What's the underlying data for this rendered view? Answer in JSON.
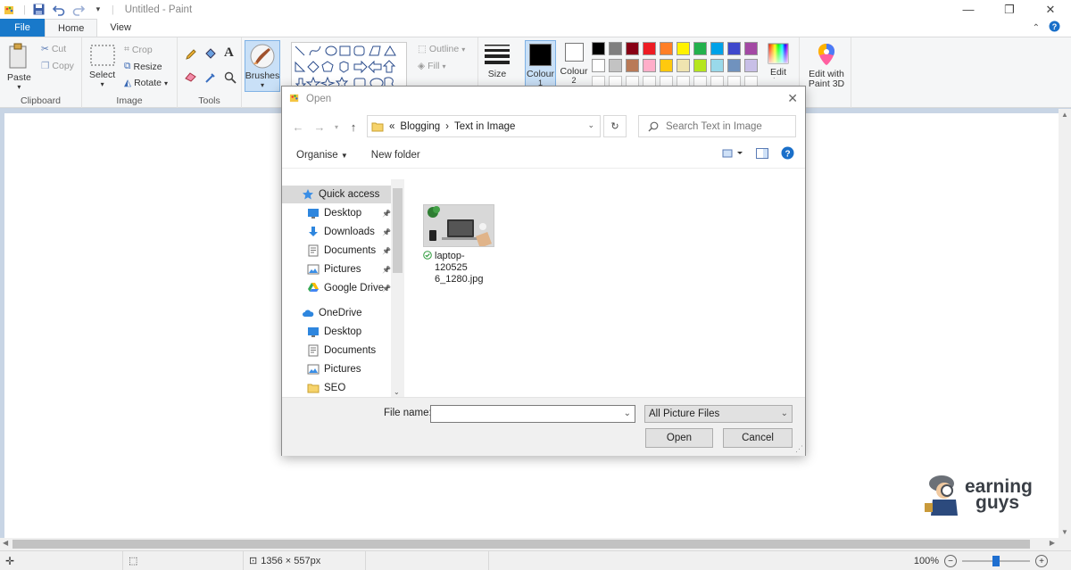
{
  "window": {
    "title": "Untitled - Paint",
    "minimize_glyph": "—",
    "restore_glyph": "❐",
    "close_glyph": "✕"
  },
  "tabs": [
    {
      "label": "File"
    },
    {
      "label": "Home"
    },
    {
      "label": "View"
    }
  ],
  "ribbon": {
    "clipboard": {
      "group": "Clipboard",
      "paste": "Paste",
      "cut": "Cut",
      "copy": "Copy"
    },
    "image": {
      "group": "Image",
      "select": "Select",
      "crop": "Crop",
      "resize": "Resize",
      "rotate": "Rotate"
    },
    "tools": {
      "group": "Tools"
    },
    "brushes": "Brushes",
    "shapes": {
      "outline": "Outline",
      "fill": "Fill"
    },
    "size": "Size",
    "colour1": "Colour",
    "colour1_num": "1",
    "colour2": "Colour",
    "colour2_num": "2",
    "edit_colours": "Edit colours",
    "paint3d_line1": "Edit with",
    "paint3d_line2": "Paint 3D",
    "palette": [
      "#000000",
      "#7f7f7f",
      "#880015",
      "#ed1c24",
      "#ff7f27",
      "#fff200",
      "#22b14c",
      "#00a2e8",
      "#3f48cc",
      "#a349a4",
      "#ffffff",
      "#c3c3c3",
      "#b97a57",
      "#ffaec9",
      "#ffc90e",
      "#efe4b0",
      "#b5e61d",
      "#99d9ea",
      "#7092be",
      "#c8bfe7"
    ]
  },
  "dialog": {
    "title": "Open",
    "path": [
      "Blogging",
      "Text in Image"
    ],
    "path_sep": "›",
    "path_prefix": "«",
    "search_placeholder": "Search Text in Image",
    "organise": "Organise",
    "new_folder": "New folder",
    "nav": [
      {
        "label": "Quick access",
        "icon": "star-icon",
        "pinned": false
      },
      {
        "label": "Desktop",
        "icon": "desktop-folder-icon",
        "pinned": true
      },
      {
        "label": "Downloads",
        "icon": "download-arrow-icon",
        "pinned": true
      },
      {
        "label": "Documents",
        "icon": "documents-folder-icon",
        "pinned": true
      },
      {
        "label": "Pictures",
        "icon": "pictures-folder-icon",
        "pinned": true
      },
      {
        "label": "Google Drive",
        "icon": "google-drive-icon",
        "pinned": true
      },
      {
        "label": "OneDrive",
        "icon": "cloud-icon",
        "pinned": false
      },
      {
        "label": "Desktop",
        "icon": "desktop-folder-icon",
        "pinned": false
      },
      {
        "label": "Documents",
        "icon": "documents-folder-icon",
        "pinned": false
      },
      {
        "label": "Pictures",
        "icon": "pictures-folder-icon",
        "pinned": false
      },
      {
        "label": "SEO",
        "icon": "folder-icon",
        "pinned": false
      }
    ],
    "file": {
      "name_line1": "laptop-120525",
      "name_line2": "6_1280.jpg"
    },
    "file_name_label": "File name:",
    "file_name_value": "",
    "file_type": "All Picture Files",
    "open_button": "Open",
    "cancel_button": "Cancel"
  },
  "status": {
    "image_size": "1356 × 557px",
    "zoom": "100%"
  },
  "watermark": {
    "line1": "earning",
    "line2": "guys"
  }
}
